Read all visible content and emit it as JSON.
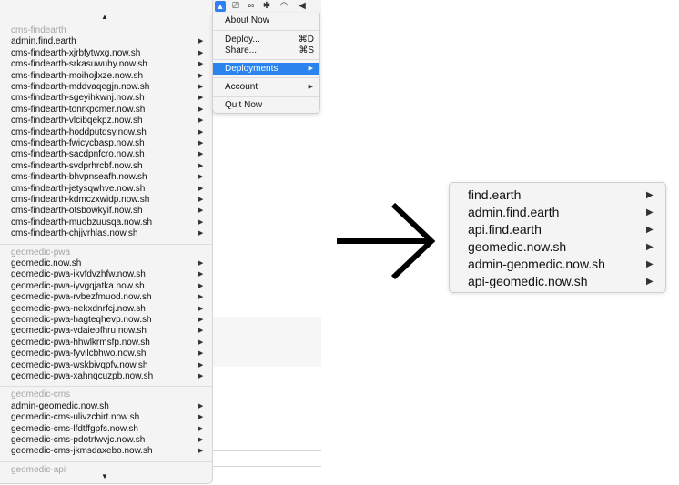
{
  "app_menu": {
    "items": [
      {
        "label": "About Now",
        "shortcut": "",
        "submenu": false,
        "active": false
      },
      {
        "label": "Deploy...",
        "shortcut": "⌘D",
        "submenu": false,
        "active": false
      },
      {
        "label": "Share...",
        "shortcut": "⌘S",
        "submenu": false,
        "active": false
      },
      {
        "label": "Deployments",
        "shortcut": "",
        "submenu": true,
        "active": true
      },
      {
        "label": "Account",
        "shortcut": "",
        "submenu": true,
        "active": false
      },
      {
        "label": "Quit Now",
        "shortcut": "",
        "submenu": false,
        "active": false
      }
    ]
  },
  "deployments_menu": {
    "scroll_up_glyph": "▲",
    "scroll_down_glyph": "▼",
    "arrow_glyph": "▶",
    "sections": [
      {
        "header": "cms-findearth",
        "items": [
          "admin.find.earth",
          "cms-findearth-xjrbfytwxg.now.sh",
          "cms-findearth-srkasuwuhy.now.sh",
          "cms-findearth-moihojlxze.now.sh",
          "cms-findearth-mddvaqegjn.now.sh",
          "cms-findearth-sgeyihkwnj.now.sh",
          "cms-findearth-tonrkpcmer.now.sh",
          "cms-findearth-vlcibqekpz.now.sh",
          "cms-findearth-hoddputdsy.now.sh",
          "cms-findearth-fwicycbasp.now.sh",
          "cms-findearth-sacdpnfcro.now.sh",
          "cms-findearth-svdprhrcbf.now.sh",
          "cms-findearth-bhvpnseafh.now.sh",
          "cms-findearth-jetysqwhve.now.sh",
          "cms-findearth-kdmczxwidp.now.sh",
          "cms-findearth-otsbowkyif.now.sh",
          "cms-findearth-muobzuusqa.now.sh",
          "cms-findearth-chjjvrhlas.now.sh"
        ]
      },
      {
        "header": "geomedic-pwa",
        "items": [
          "geomedic.now.sh",
          "geomedic-pwa-ikvfdvzhfw.now.sh",
          "geomedic-pwa-iyvgqjatka.now.sh",
          "geomedic-pwa-rvbezfmuod.now.sh",
          "geomedic-pwa-nekxdnrfcj.now.sh",
          "geomedic-pwa-hagteqhevp.now.sh",
          "geomedic-pwa-vdaieofhru.now.sh",
          "geomedic-pwa-hhwlkrmsfp.now.sh",
          "geomedic-pwa-fyvilcbhwo.now.sh",
          "geomedic-pwa-wskbivqpfv.now.sh",
          "geomedic-pwa-xahnqcuzpb.now.sh"
        ]
      },
      {
        "header": "geomedic-cms",
        "items": [
          "admin-geomedic.now.sh",
          "geomedic-cms-ulivzcbirt.now.sh",
          "geomedic-cms-lfdtffgpfs.now.sh",
          "geomedic-cms-pdotrtwvjc.now.sh",
          "geomedic-cms-jkmsdaxebo.now.sh"
        ]
      },
      {
        "header": "geomedic-api",
        "items": []
      }
    ]
  },
  "zoomed_menu": {
    "items": [
      "find.earth",
      "admin.find.earth",
      "api.find.earth",
      "geomedic.now.sh",
      "admin-geomedic.now.sh",
      "api-geomedic.now.sh"
    ]
  },
  "menubar": {
    "icons": [
      "now-app-icon",
      "screen-share-icon",
      "glasses-icon",
      "bluetooth-icon",
      "wifi-icon",
      "volume-icon"
    ],
    "glyphs": [
      "▲",
      "⎚",
      "∞",
      "✱",
      "◠",
      "◀"
    ],
    "accent_color": "#2b84ee"
  }
}
